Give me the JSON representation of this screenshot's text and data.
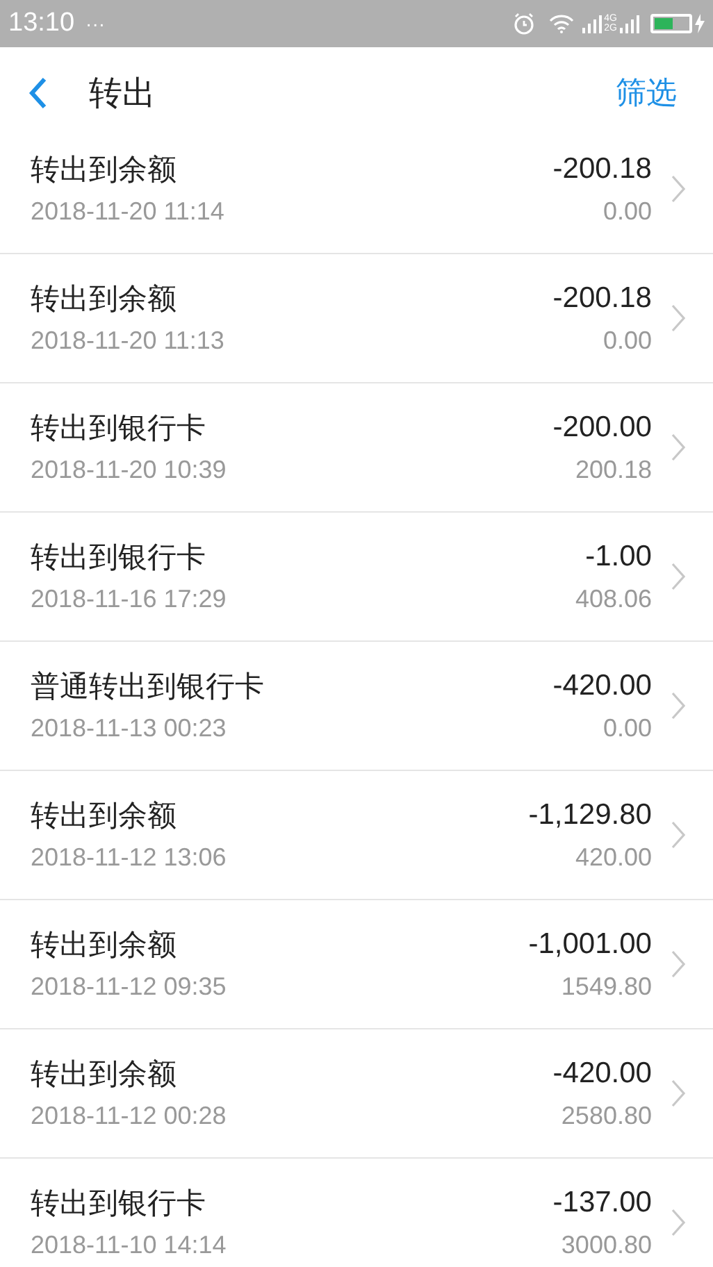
{
  "status_bar": {
    "time": "13:10",
    "more": "···",
    "network_labels": [
      "4G",
      "2G"
    ],
    "charging": true
  },
  "header": {
    "title": "转出",
    "action": "筛选"
  },
  "rows": [
    {
      "title": "转出到余额",
      "time": "2018-11-20 11:14",
      "amount": "-200.18",
      "balance": "0.00"
    },
    {
      "title": "转出到余额",
      "time": "2018-11-20 11:13",
      "amount": "-200.18",
      "balance": "0.00"
    },
    {
      "title": "转出到银行卡",
      "time": "2018-11-20 10:39",
      "amount": "-200.00",
      "balance": "200.18"
    },
    {
      "title": "转出到银行卡",
      "time": "2018-11-16 17:29",
      "amount": "-1.00",
      "balance": "408.06"
    },
    {
      "title": "普通转出到银行卡",
      "time": "2018-11-13 00:23",
      "amount": "-420.00",
      "balance": "0.00"
    },
    {
      "title": "转出到余额",
      "time": "2018-11-12 13:06",
      "amount": "-1,129.80",
      "balance": "420.00"
    },
    {
      "title": "转出到余额",
      "time": "2018-11-12 09:35",
      "amount": "-1,001.00",
      "balance": "1549.80"
    },
    {
      "title": "转出到余额",
      "time": "2018-11-12 00:28",
      "amount": "-420.00",
      "balance": "2580.80"
    },
    {
      "title": "转出到银行卡",
      "time": "2018-11-10 14:14",
      "amount": "-137.00",
      "balance": "3000.80"
    }
  ]
}
